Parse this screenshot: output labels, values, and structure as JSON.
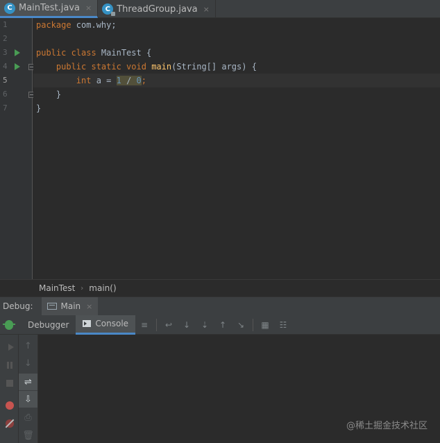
{
  "tabs": [
    {
      "name": "MainTest.java",
      "active": true,
      "icon": "java-class-icon"
    },
    {
      "name": "ThreadGroup.java",
      "active": false,
      "icon": "java-class-locked-icon"
    }
  ],
  "tab_close_glyph": "×",
  "gutter": {
    "line_numbers": [
      "1",
      "2",
      "3",
      "4",
      "5",
      "6",
      "7"
    ],
    "current_line": "5",
    "run_markers": [
      "3",
      "4"
    ]
  },
  "code": {
    "l1_kw": "package",
    "l1_rest": " com.why;",
    "l3_kw": "public class",
    "l3_rest": " MainTest {",
    "l4_kw": "public static void",
    "l4_fn": "main",
    "l4_rest": "(String[] args) {",
    "l5_kw": "int",
    "l5_pre": " a = ",
    "l5_num1": "1",
    "l5_op": " / ",
    "l5_num2": "0",
    "l5_end": ";",
    "l6": "}",
    "l7": "}"
  },
  "breadcrumb": {
    "class": "MainTest",
    "method": "main()",
    "separator": "›"
  },
  "debug": {
    "label": "Debug:",
    "run_tab": "Main",
    "subtabs": {
      "debugger": "Debugger",
      "console": "Console"
    },
    "toolbar_icons": [
      "menu-icon",
      "show-execution-point-icon",
      "step-over-icon",
      "step-into-icon",
      "force-step-into-icon",
      "step-out-icon",
      "run-to-cursor-icon",
      "evaluate-expression-icon",
      "trace-icon"
    ]
  },
  "toolbar_glyphs": [
    "≡",
    "↩",
    "↓",
    "⇣",
    "↑",
    "↘",
    "▦",
    "☷"
  ],
  "side_glyphs": [
    "↑",
    "↓",
    "⇌",
    "⇩",
    "⎙",
    "🗑"
  ],
  "colors": {
    "accent": "#4a88c7",
    "run_green": "#499c54",
    "keyword": "#cc7832",
    "function": "#ffc66d",
    "number": "#6897bb"
  },
  "watermark": "@稀土掘金技术社区"
}
